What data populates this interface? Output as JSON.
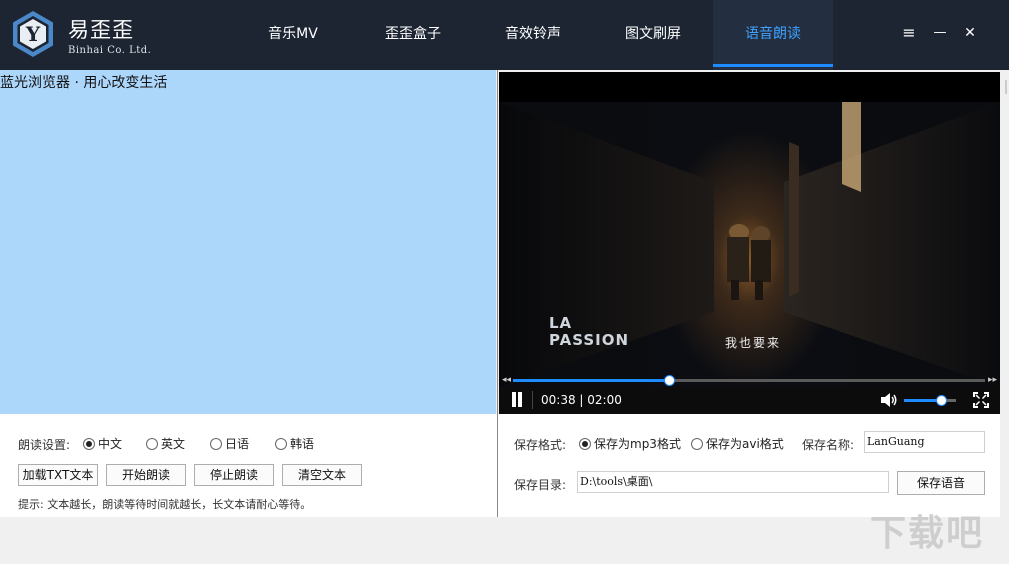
{
  "app": {
    "logo_letter": "Y",
    "brand_name": "易歪歪",
    "brand_subtitle": "Binhai Co. Ltd."
  },
  "nav": {
    "items": [
      {
        "label": "音乐MV"
      },
      {
        "label": "歪歪盒子"
      },
      {
        "label": "音效铃声"
      },
      {
        "label": "图文刷屏"
      },
      {
        "label": "语音朗读",
        "active": true
      }
    ]
  },
  "window_controls": {
    "menu": "≡",
    "minimize": "—",
    "close": "✕"
  },
  "text_area": {
    "content": "蓝光浏览器 · 用心改变生活"
  },
  "video": {
    "overlay_title": [
      "LA",
      "PASSION"
    ],
    "subtitle": "我也要来",
    "current_time": "00:38",
    "duration": "02:00",
    "time_display": "00:38 | 02:00",
    "progress": 0.33,
    "volume": 0.72
  },
  "read_settings": {
    "label": "朗读设置:",
    "languages": [
      {
        "label": "中文",
        "checked": true
      },
      {
        "label": "英文",
        "checked": false
      },
      {
        "label": "日语",
        "checked": false
      },
      {
        "label": "韩语",
        "checked": false
      }
    ]
  },
  "buttons": {
    "load_txt": "加载TXT文本",
    "start_read": "开始朗读",
    "stop_read": "停止朗读",
    "clear_text": "清空文本",
    "save_voice": "保存语音"
  },
  "hint": "提示: 文本越长，朗读等待时间就越长，长文本请耐心等待。",
  "save": {
    "format_label": "保存格式:",
    "formats": [
      {
        "label": "保存为mp3格式",
        "checked": true
      },
      {
        "label": "保存为avi格式",
        "checked": false
      }
    ],
    "name_label": "保存名称:",
    "name_value": "LanGuang",
    "dir_label": "保存目录:",
    "dir_value": "D:\\tools\\桌面\\"
  },
  "watermark": "下载吧",
  "colors": {
    "topbar": "#1d2533",
    "accent": "#1e8cff",
    "text_area_bg": "#add6fb"
  }
}
